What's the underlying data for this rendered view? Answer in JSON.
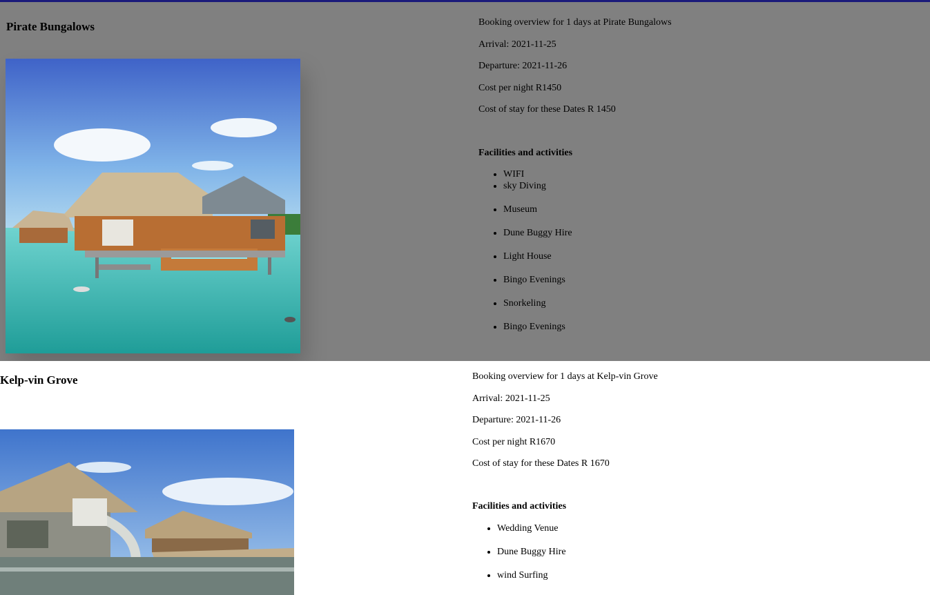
{
  "listings": [
    {
      "name": "Pirate Bungalows",
      "overview": "Booking overview for 1 days at Pirate Bungalows",
      "arrival": "Arrival: 2021-11-25",
      "departure": "Departure: 2021-11-26",
      "cost_per_night": "Cost per night R1450",
      "cost_of_stay": "Cost of stay for these Dates R 1450",
      "facilities_title": "Facilities and activities",
      "facilities": [
        "WIFI",
        "sky Diving",
        "Museum",
        "Dune Buggy Hire",
        "Light House",
        "Bingo Evenings",
        "Snorkeling",
        "Bingo Evenings"
      ]
    },
    {
      "name": "Kelp-vin Grove",
      "overview": "Booking overview for 1 days at Kelp-vin Grove",
      "arrival": "Arrival: 2021-11-25",
      "departure": "Departure: 2021-11-26",
      "cost_per_night": "Cost per night R1670",
      "cost_of_stay": "Cost of stay for these Dates R 1670",
      "facilities_title": "Facilities and activities",
      "facilities": [
        "Wedding Venue",
        "Dune Buggy Hire",
        "wind Surfing"
      ]
    }
  ],
  "colors": {
    "highlight_card": "#808080",
    "top_rule": "#1a1a7a"
  }
}
